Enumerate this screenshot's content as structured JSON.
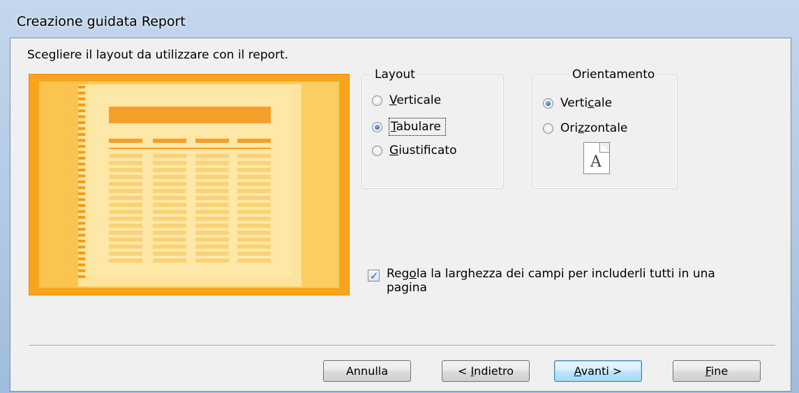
{
  "window": {
    "title": "Creazione guidata Report"
  },
  "instruction": "Scegliere il layout da utilizzare con il report.",
  "layout_group": {
    "legend": "Layout",
    "options": [
      {
        "label": "Verticale",
        "accel_pre": "",
        "accel": "V",
        "accel_post": "erticale",
        "selected": false
      },
      {
        "label": "Tabulare",
        "accel_pre": "",
        "accel": "T",
        "accel_post": "abulare",
        "selected": true
      },
      {
        "label": "Giustificato",
        "accel_pre": "",
        "accel": "G",
        "accel_post": "iustificato",
        "selected": false
      }
    ]
  },
  "orientation_group": {
    "legend": "Orientamento",
    "options": [
      {
        "label": "Verticale",
        "accel_pre": "Verti",
        "accel": "c",
        "accel_post": "ale",
        "selected": true
      },
      {
        "label": "Orizzontale",
        "accel_pre": "Ori",
        "accel": "z",
        "accel_post": "zontale",
        "selected": false
      }
    ],
    "icon_letter": "A"
  },
  "fit_fields": {
    "label_pre": "Reg",
    "label_accel": "o",
    "label_post": "la la larghezza dei campi per includerli tutti in una pagina",
    "checked": true
  },
  "buttons": {
    "cancel": {
      "pre": "Annulla",
      "accel": "",
      "post": ""
    },
    "back": {
      "pre": "< ",
      "accel": "I",
      "post": "ndietro"
    },
    "next": {
      "pre": "",
      "accel": "A",
      "post": "vanti >"
    },
    "finish": {
      "pre": "",
      "accel": "F",
      "post": "ine"
    }
  },
  "colors": {
    "preview_bg": "#f9a41d",
    "selected_radio": "#1d63b8",
    "default_button_border": "#3c7fb1"
  }
}
